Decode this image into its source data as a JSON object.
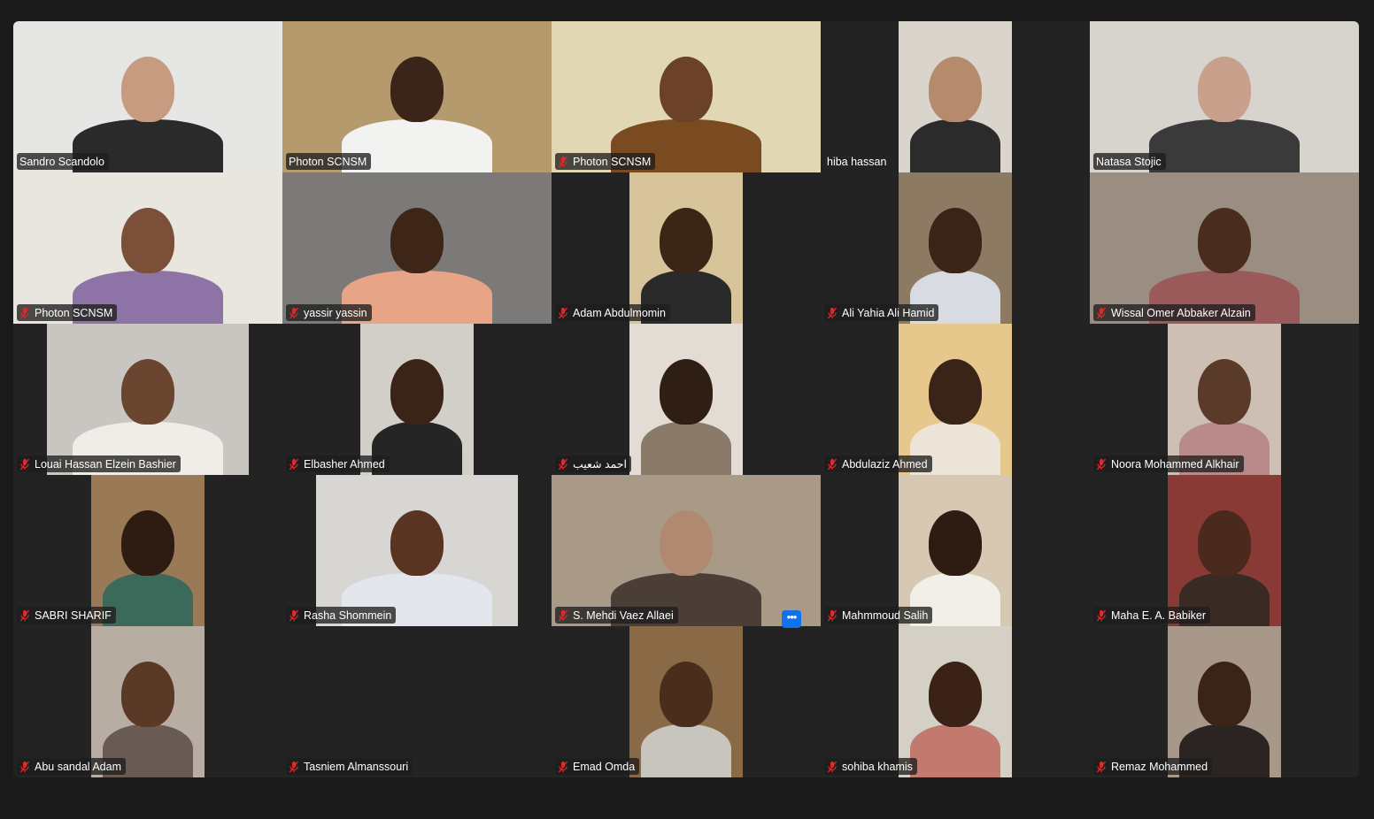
{
  "window": {
    "background": "#1a1a1a",
    "panel": "#232323",
    "active_speaker_color": "#23d160"
  },
  "gallery": {
    "more_options_label": "•••",
    "participants": [
      {
        "name": "Sandro Scandolo",
        "muted": false,
        "video": "full",
        "bg": "#e6e6e4",
        "skin": "#c79b80",
        "top": "#2a2a2a"
      },
      {
        "name": "Photon SCNSM",
        "muted": false,
        "video": "full",
        "bg": "#b59a6e",
        "skin": "#3b2418",
        "top": "#f2f2f0",
        "active": true
      },
      {
        "name": "Photon SCNSM",
        "muted": true,
        "video": "full",
        "bg": "#e2d7b4",
        "skin": "#6b4128",
        "top": "#7a4a20"
      },
      {
        "name": "hiba hassan",
        "muted": false,
        "video": "narrow",
        "bg": "#d9d4cc",
        "skin": "#b68a6c",
        "top": "#2b2b2b",
        "plain_tag": true
      },
      {
        "name": "Natasa Stojic",
        "muted": false,
        "video": "full",
        "bg": "#d7d3cd",
        "skin": "#c9a08c",
        "top": "#3a3a3a"
      },
      {
        "name": "Photon SCNSM",
        "muted": true,
        "video": "full",
        "bg": "#e9e5df",
        "skin": "#7a5038",
        "top": "#8e74a6"
      },
      {
        "name": "yassir yassin",
        "muted": true,
        "video": "full",
        "bg": "#7c7a78",
        "skin": "#3d2618",
        "top": "#e8a486"
      },
      {
        "name": "Adam Abdulmomin",
        "muted": true,
        "video": "narrow",
        "bg": "#d8c49a",
        "skin": "#3a2516",
        "top": "#2a2a2a"
      },
      {
        "name": "Ali Yahia Ali Hamid",
        "muted": true,
        "video": "narrow",
        "bg": "#8c7a62",
        "skin": "#3a2418",
        "top": "#d8dbe2"
      },
      {
        "name": "Wissal Omer Abbaker Alzain",
        "muted": true,
        "video": "full",
        "bg": "#9a8e82",
        "skin": "#4a2c1e",
        "top": "#9a5a5a"
      },
      {
        "name": "Louai Hassan Elzein Bashier",
        "muted": true,
        "video": "mid",
        "bg": "#c9c6c2",
        "skin": "#6a4630",
        "top": "#f0ece8"
      },
      {
        "name": "Elbasher Ahmed",
        "muted": true,
        "video": "narrow",
        "bg": "#d2cfc8",
        "skin": "#3a2418",
        "top": "#252525"
      },
      {
        "name": "احمد شعيب",
        "muted": true,
        "video": "narrow",
        "bg": "#e2dcd4",
        "skin": "#2e1e14",
        "top": "#8a7a6a"
      },
      {
        "name": "Abdulaziz Ahmed",
        "muted": true,
        "video": "narrow",
        "bg": "#e6c88c",
        "skin": "#3a2418",
        "top": "#ece4d8"
      },
      {
        "name": "Noora Mohammed Alkhair",
        "muted": true,
        "video": "narrow",
        "bg": "#cdbfb4",
        "skin": "#5a3a28",
        "top": "#b88a8a"
      },
      {
        "name": "SABRI SHARIF",
        "muted": true,
        "video": "narrow",
        "bg": "#9a7a56",
        "skin": "#2e1c12",
        "top": "#3c6a5a"
      },
      {
        "name": "Rasha Shommein",
        "muted": true,
        "video": "mid",
        "bg": "#d8d6d2",
        "skin": "#5a3422",
        "top": "#e4e6ee"
      },
      {
        "name": "S. Mehdi Vaez Allaei",
        "muted": true,
        "video": "full",
        "bg": "#a89a86",
        "skin": "#b08a70",
        "top": "#4a3e36"
      },
      {
        "name": "Mahmmoud Salih",
        "muted": true,
        "video": "narrow",
        "bg": "#d6c8b2",
        "skin": "#2e1c12",
        "top": "#f2efe8"
      },
      {
        "name": "Maha E. A. Babiker",
        "muted": true,
        "video": "narrow",
        "bg": "#8a3a34",
        "skin": "#4a2a1c",
        "top": "#3a2a24"
      },
      {
        "name": "Abu sandal Adam",
        "muted": true,
        "video": "narrow",
        "bg": "#b7ada2",
        "skin": "#5a3a26",
        "top": "#6a5a54"
      },
      {
        "name": "Tasniem Almanssouri",
        "muted": true,
        "video": "none"
      },
      {
        "name": "Emad Omda",
        "muted": true,
        "video": "narrow",
        "bg": "#8a6a46",
        "skin": "#4a2e1c",
        "top": "#c8c4be"
      },
      {
        "name": "sohiba khamis",
        "muted": true,
        "video": "narrow",
        "bg": "#d4d0c6",
        "skin": "#3a2216",
        "top": "#c27a6e"
      },
      {
        "name": "Remaz Mohammed",
        "muted": true,
        "video": "narrow",
        "bg": "#a8988a",
        "skin": "#3a2418",
        "top": "#2a2422"
      }
    ]
  }
}
